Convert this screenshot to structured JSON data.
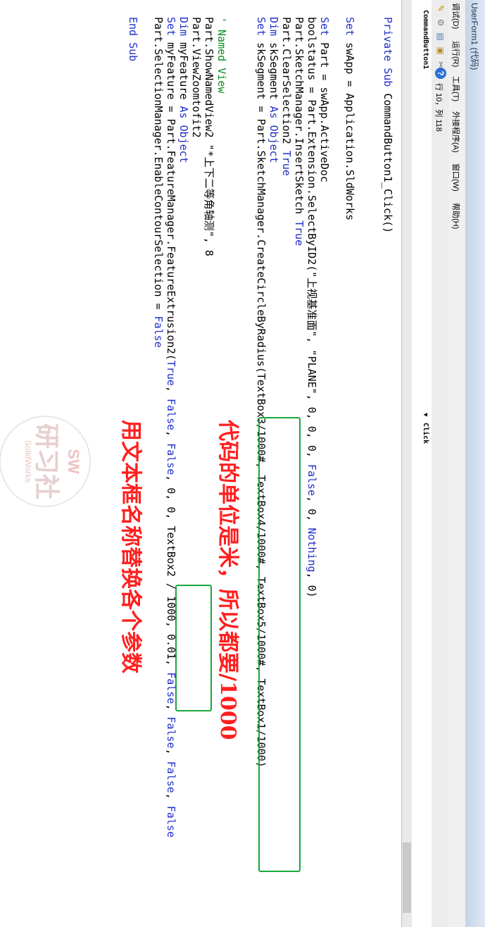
{
  "window": {
    "title": "UserForm1 (代码)"
  },
  "menu": [
    "调试(D)",
    "运行(R)",
    "工具(T)",
    "外接程序(A)",
    "窗口(W)",
    "帮助(H)"
  ],
  "toolbar": {
    "position": "行 10，列 118"
  },
  "combos": {
    "object": "CommandButton1",
    "procedure": "Click"
  },
  "code": {
    "lines": [
      [
        {
          "t": "Private Sub ",
          "k": "kw"
        },
        {
          "t": "CommandButton1_Click()"
        }
      ],
      [
        {
          "t": ""
        }
      ],
      [
        {
          "t": "Set ",
          "k": "kw"
        },
        {
          "t": "swApp = Application.SldWorks"
        }
      ],
      [
        {
          "t": ""
        }
      ],
      [
        {
          "t": "Set ",
          "k": "kw"
        },
        {
          "t": "Part = swApp.ActiveDoc"
        }
      ],
      [
        {
          "t": "boolstatus = Part.Extension.SelectByID2(\"上视基准面\", \"PLANE\", 0, 0, 0, "
        },
        {
          "t": "False",
          "k": "kw"
        },
        {
          "t": ", 0, "
        },
        {
          "t": "Nothing",
          "k": "kw"
        },
        {
          "t": ", 0)"
        }
      ],
      [
        {
          "t": "Part.SketchManager.InsertSketch "
        },
        {
          "t": "True",
          "k": "kw"
        }
      ],
      [
        {
          "t": "Part.ClearSelection2 "
        },
        {
          "t": "True",
          "k": "kw"
        }
      ],
      [
        {
          "t": "Dim ",
          "k": "kw"
        },
        {
          "t": "skSegment "
        },
        {
          "t": "As Object",
          "k": "kw"
        }
      ],
      [
        {
          "t": "Set ",
          "k": "kw"
        },
        {
          "t": "skSegment = Part.SketchManager.CreateCircleByRadius(TextBox3/1000#, TextBox4/1000#, TextBox5/1000#, TextBox1/1000)"
        }
      ],
      [
        {
          "t": ""
        }
      ],
      [
        {
          "t": "' Named View",
          "k": "cm"
        }
      ],
      [
        {
          "t": "Part.ShowNamedView2 \"*上下二等角轴测\", 8"
        }
      ],
      [
        {
          "t": "Part.ViewZoomtofit2"
        }
      ],
      [
        {
          "t": "Dim ",
          "k": "kw"
        },
        {
          "t": "myFeature "
        },
        {
          "t": "As Object",
          "k": "kw"
        }
      ],
      [
        {
          "t": "Set ",
          "k": "kw"
        },
        {
          "t": "myFeature = Part.FeatureManager.FeatureExtrusion2("
        },
        {
          "t": "True",
          "k": "kw"
        },
        {
          "t": ", "
        },
        {
          "t": "False",
          "k": "kw"
        },
        {
          "t": ", "
        },
        {
          "t": "False",
          "k": "kw"
        },
        {
          "t": ", 0, 0, TextBox2 / 1000, 0.01, "
        },
        {
          "t": "False",
          "k": "kw"
        },
        {
          "t": ", "
        },
        {
          "t": "False",
          "k": "kw"
        },
        {
          "t": ", "
        },
        {
          "t": "False",
          "k": "kw"
        },
        {
          "t": ", "
        },
        {
          "t": "False",
          "k": "kw"
        }
      ],
      [
        {
          "t": "Part.SelectionManager.EnableContourSelection = "
        },
        {
          "t": "False",
          "k": "kw"
        }
      ],
      [
        {
          "t": ""
        }
      ],
      [
        {
          "t": "End Sub",
          "k": "kw"
        }
      ]
    ]
  },
  "annotations": {
    "unit_note": "代码的单位是米，所以都要/1000",
    "textbox_note": "用文本框名称替换各个参数"
  },
  "watermark": {
    "top": "SW",
    "middle": "研习社",
    "bottom": "SolidWorks"
  }
}
